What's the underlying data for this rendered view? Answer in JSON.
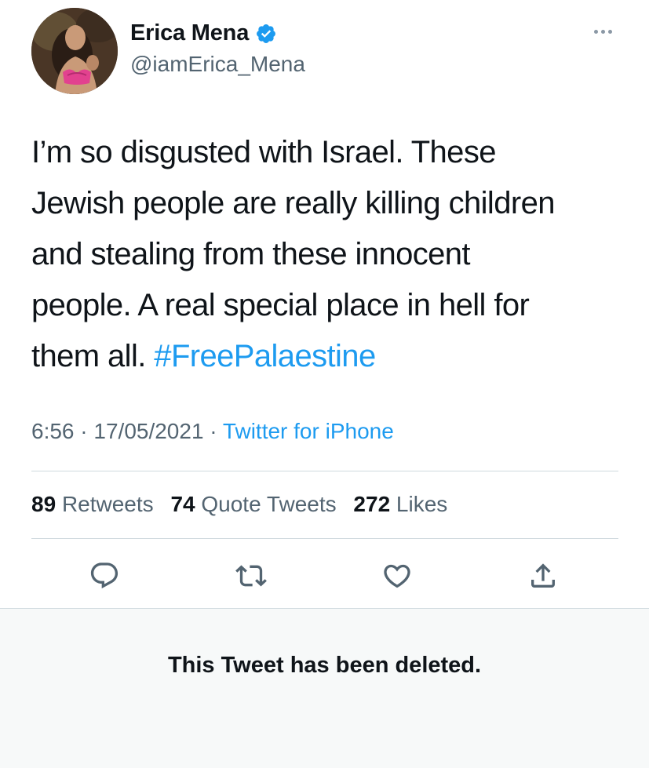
{
  "author": {
    "display_name": "Erica Mena",
    "handle": "@iamErica_Mena",
    "verified": true,
    "avatar_icon": "profile-photo"
  },
  "menu": {
    "icon": "more-dots-icon"
  },
  "tweet": {
    "lines": [
      "I’m so disgusted with Israel. These",
      "Jewish people are really killing children",
      "and stealing from these innocent",
      "people. A real special place in hell for",
      "them all. "
    ],
    "hashtag": "#FreePalaestine"
  },
  "meta": {
    "time": "6:56",
    "separator": " · ",
    "date": "17/05/2021",
    "source": "Twitter for iPhone"
  },
  "stats": {
    "retweets": {
      "count": "89",
      "label": "Retweets"
    },
    "quotes": {
      "count": "74",
      "label": "Quote Tweets"
    },
    "likes": {
      "count": "272",
      "label": "Likes"
    }
  },
  "actions": {
    "reply_icon": "reply-icon",
    "retweet_icon": "retweet-icon",
    "like_icon": "heart-icon",
    "share_icon": "share-icon"
  },
  "deleted_notice": "This Tweet has been deleted.",
  "colors": {
    "link": "#1d9bf0",
    "secondary_text": "#536471",
    "icon": "#536471",
    "divider": "#cfd9de",
    "notice_bg": "#f7f9f9"
  }
}
